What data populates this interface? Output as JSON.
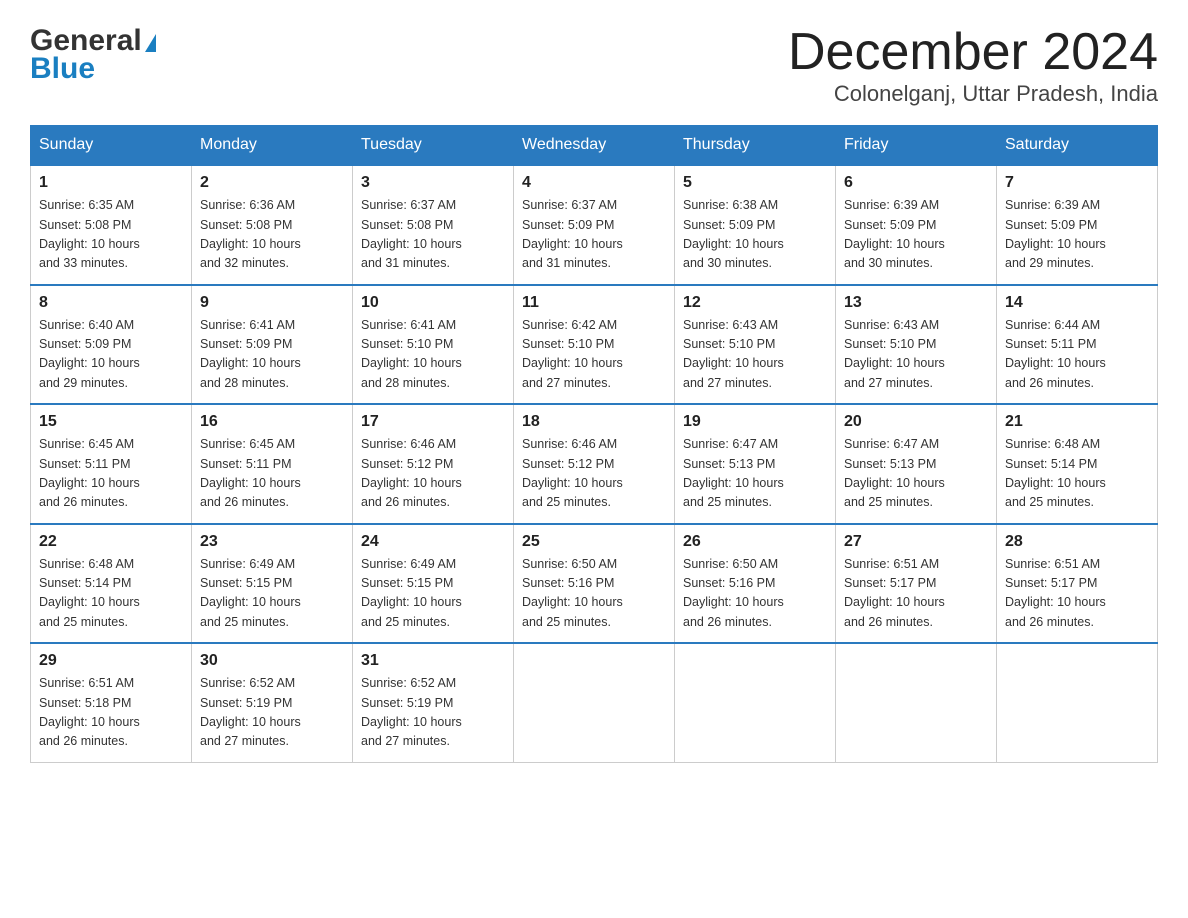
{
  "header": {
    "logo_general": "General",
    "logo_blue": "Blue",
    "month_title": "December 2024",
    "location": "Colonelganj, Uttar Pradesh, India"
  },
  "days_of_week": [
    "Sunday",
    "Monday",
    "Tuesday",
    "Wednesday",
    "Thursday",
    "Friday",
    "Saturday"
  ],
  "weeks": [
    [
      {
        "day": "1",
        "sunrise": "6:35 AM",
        "sunset": "5:08 PM",
        "daylight": "10 hours and 33 minutes."
      },
      {
        "day": "2",
        "sunrise": "6:36 AM",
        "sunset": "5:08 PM",
        "daylight": "10 hours and 32 minutes."
      },
      {
        "day": "3",
        "sunrise": "6:37 AM",
        "sunset": "5:08 PM",
        "daylight": "10 hours and 31 minutes."
      },
      {
        "day": "4",
        "sunrise": "6:37 AM",
        "sunset": "5:09 PM",
        "daylight": "10 hours and 31 minutes."
      },
      {
        "day": "5",
        "sunrise": "6:38 AM",
        "sunset": "5:09 PM",
        "daylight": "10 hours and 30 minutes."
      },
      {
        "day": "6",
        "sunrise": "6:39 AM",
        "sunset": "5:09 PM",
        "daylight": "10 hours and 30 minutes."
      },
      {
        "day": "7",
        "sunrise": "6:39 AM",
        "sunset": "5:09 PM",
        "daylight": "10 hours and 29 minutes."
      }
    ],
    [
      {
        "day": "8",
        "sunrise": "6:40 AM",
        "sunset": "5:09 PM",
        "daylight": "10 hours and 29 minutes."
      },
      {
        "day": "9",
        "sunrise": "6:41 AM",
        "sunset": "5:09 PM",
        "daylight": "10 hours and 28 minutes."
      },
      {
        "day": "10",
        "sunrise": "6:41 AM",
        "sunset": "5:10 PM",
        "daylight": "10 hours and 28 minutes."
      },
      {
        "day": "11",
        "sunrise": "6:42 AM",
        "sunset": "5:10 PM",
        "daylight": "10 hours and 27 minutes."
      },
      {
        "day": "12",
        "sunrise": "6:43 AM",
        "sunset": "5:10 PM",
        "daylight": "10 hours and 27 minutes."
      },
      {
        "day": "13",
        "sunrise": "6:43 AM",
        "sunset": "5:10 PM",
        "daylight": "10 hours and 27 minutes."
      },
      {
        "day": "14",
        "sunrise": "6:44 AM",
        "sunset": "5:11 PM",
        "daylight": "10 hours and 26 minutes."
      }
    ],
    [
      {
        "day": "15",
        "sunrise": "6:45 AM",
        "sunset": "5:11 PM",
        "daylight": "10 hours and 26 minutes."
      },
      {
        "day": "16",
        "sunrise": "6:45 AM",
        "sunset": "5:11 PM",
        "daylight": "10 hours and 26 minutes."
      },
      {
        "day": "17",
        "sunrise": "6:46 AM",
        "sunset": "5:12 PM",
        "daylight": "10 hours and 26 minutes."
      },
      {
        "day": "18",
        "sunrise": "6:46 AM",
        "sunset": "5:12 PM",
        "daylight": "10 hours and 25 minutes."
      },
      {
        "day": "19",
        "sunrise": "6:47 AM",
        "sunset": "5:13 PM",
        "daylight": "10 hours and 25 minutes."
      },
      {
        "day": "20",
        "sunrise": "6:47 AM",
        "sunset": "5:13 PM",
        "daylight": "10 hours and 25 minutes."
      },
      {
        "day": "21",
        "sunrise": "6:48 AM",
        "sunset": "5:14 PM",
        "daylight": "10 hours and 25 minutes."
      }
    ],
    [
      {
        "day": "22",
        "sunrise": "6:48 AM",
        "sunset": "5:14 PM",
        "daylight": "10 hours and 25 minutes."
      },
      {
        "day": "23",
        "sunrise": "6:49 AM",
        "sunset": "5:15 PM",
        "daylight": "10 hours and 25 minutes."
      },
      {
        "day": "24",
        "sunrise": "6:49 AM",
        "sunset": "5:15 PM",
        "daylight": "10 hours and 25 minutes."
      },
      {
        "day": "25",
        "sunrise": "6:50 AM",
        "sunset": "5:16 PM",
        "daylight": "10 hours and 25 minutes."
      },
      {
        "day": "26",
        "sunrise": "6:50 AM",
        "sunset": "5:16 PM",
        "daylight": "10 hours and 26 minutes."
      },
      {
        "day": "27",
        "sunrise": "6:51 AM",
        "sunset": "5:17 PM",
        "daylight": "10 hours and 26 minutes."
      },
      {
        "day": "28",
        "sunrise": "6:51 AM",
        "sunset": "5:17 PM",
        "daylight": "10 hours and 26 minutes."
      }
    ],
    [
      {
        "day": "29",
        "sunrise": "6:51 AM",
        "sunset": "5:18 PM",
        "daylight": "10 hours and 26 minutes."
      },
      {
        "day": "30",
        "sunrise": "6:52 AM",
        "sunset": "5:19 PM",
        "daylight": "10 hours and 27 minutes."
      },
      {
        "day": "31",
        "sunrise": "6:52 AM",
        "sunset": "5:19 PM",
        "daylight": "10 hours and 27 minutes."
      },
      null,
      null,
      null,
      null
    ]
  ],
  "labels": {
    "sunrise": "Sunrise: ",
    "sunset": "Sunset: ",
    "daylight": "Daylight: "
  }
}
